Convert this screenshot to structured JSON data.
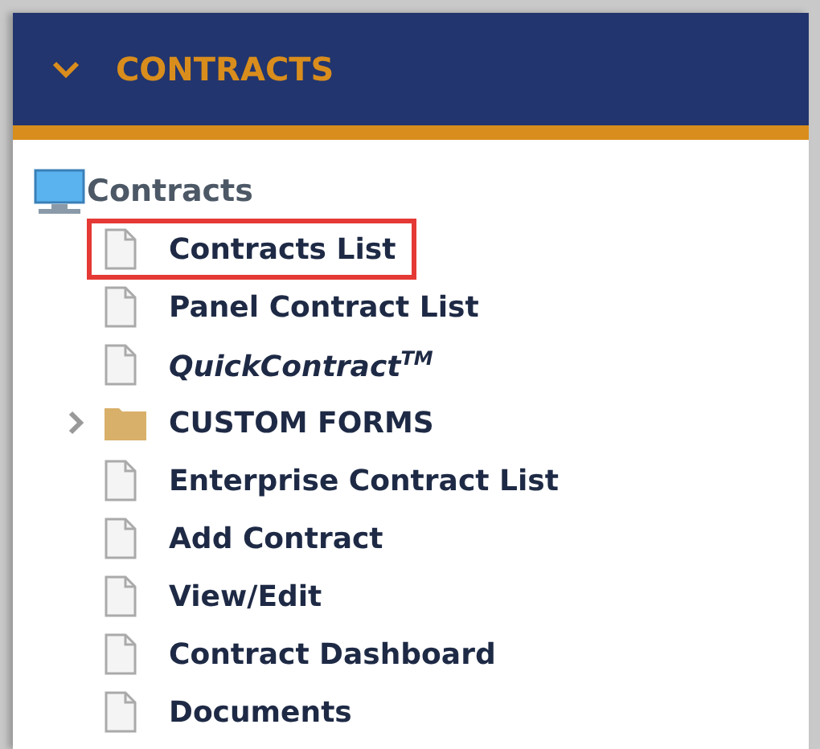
{
  "section": {
    "title": "CONTRACTS",
    "expanded": true
  },
  "tree": {
    "label": "Contracts",
    "children": [
      {
        "label": "Contracts List",
        "kind": "page",
        "italic": false,
        "selected": true
      },
      {
        "label": "Panel Contract List",
        "kind": "page",
        "italic": false,
        "selected": false
      },
      {
        "label": "QuickContract$^{TM}$",
        "kind": "page",
        "italic": true,
        "selected": false
      },
      {
        "label": "CUSTOM FORMS",
        "kind": "folder",
        "italic": false,
        "expanded": false,
        "selected": false
      },
      {
        "label": "Enterprise Contract List",
        "kind": "page",
        "italic": false,
        "selected": false
      },
      {
        "label": "Add Contract",
        "kind": "page",
        "italic": false,
        "selected": false
      },
      {
        "label": "View/Edit",
        "kind": "page",
        "italic": false,
        "selected": false
      },
      {
        "label": "Contract Dashboard",
        "kind": "page",
        "italic": false,
        "selected": false
      },
      {
        "label": "Documents",
        "kind": "page",
        "italic": false,
        "selected": false
      }
    ]
  }
}
